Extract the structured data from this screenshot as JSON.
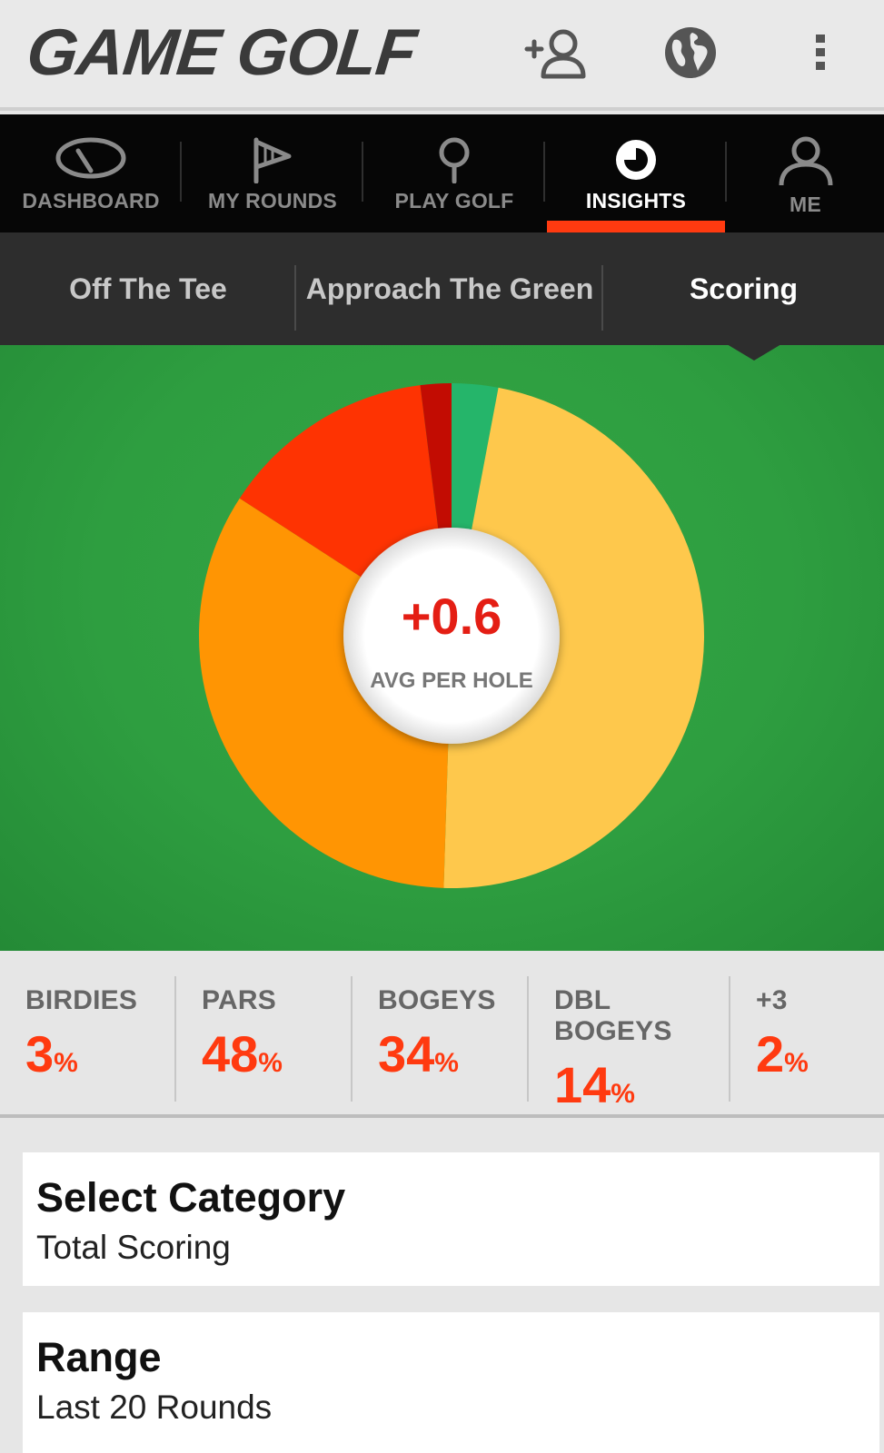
{
  "header": {
    "logo": "GAME GOLF",
    "icons": [
      "add-friend-icon",
      "globe-icon",
      "overflow-menu-icon"
    ]
  },
  "nav": {
    "items": [
      {
        "label": "DASHBOARD",
        "icon": "gauge-icon"
      },
      {
        "label": "MY ROUNDS",
        "icon": "flag-icon"
      },
      {
        "label": "PLAY GOLF",
        "icon": "pin-icon"
      },
      {
        "label": "INSIGHTS",
        "icon": "pie-chart-icon",
        "active": true
      },
      {
        "label": "ME",
        "icon": "person-icon"
      }
    ]
  },
  "subtabs": [
    {
      "label": "Off The Tee"
    },
    {
      "label": "Approach The Green"
    },
    {
      "label": "Scoring",
      "active": true
    }
  ],
  "chart_data": {
    "type": "pie",
    "categories": [
      "Birdies",
      "Pars",
      "Bogeys",
      "Dbl Bogeys",
      "+3"
    ],
    "values": [
      3,
      48,
      34,
      14,
      2
    ],
    "colors": [
      "#25b56a",
      "#fec84c",
      "#ff9503",
      "#fe3302",
      "#c20c02"
    ],
    "center_value": "+0.6",
    "center_label": "AVG PER HOLE"
  },
  "stats": [
    {
      "label": "BIRDIES",
      "value": "3",
      "unit": "%"
    },
    {
      "label": "PARS",
      "value": "48",
      "unit": "%"
    },
    {
      "label": "BOGEYS",
      "value": "34",
      "unit": "%"
    },
    {
      "label": "DBL BOGEYS",
      "value": "14",
      "unit": "%"
    },
    {
      "label": "+3",
      "value": "2",
      "unit": "%"
    }
  ],
  "category": {
    "title": "Select Category",
    "value": "Total Scoring"
  },
  "range": {
    "title": "Range",
    "value": "Last 20 Rounds"
  },
  "colors": {
    "accent": "#ff3a10",
    "nav_bg": "#060606",
    "subtab_bg": "#2d2d2d",
    "chart_bg": "#2e9e40"
  }
}
